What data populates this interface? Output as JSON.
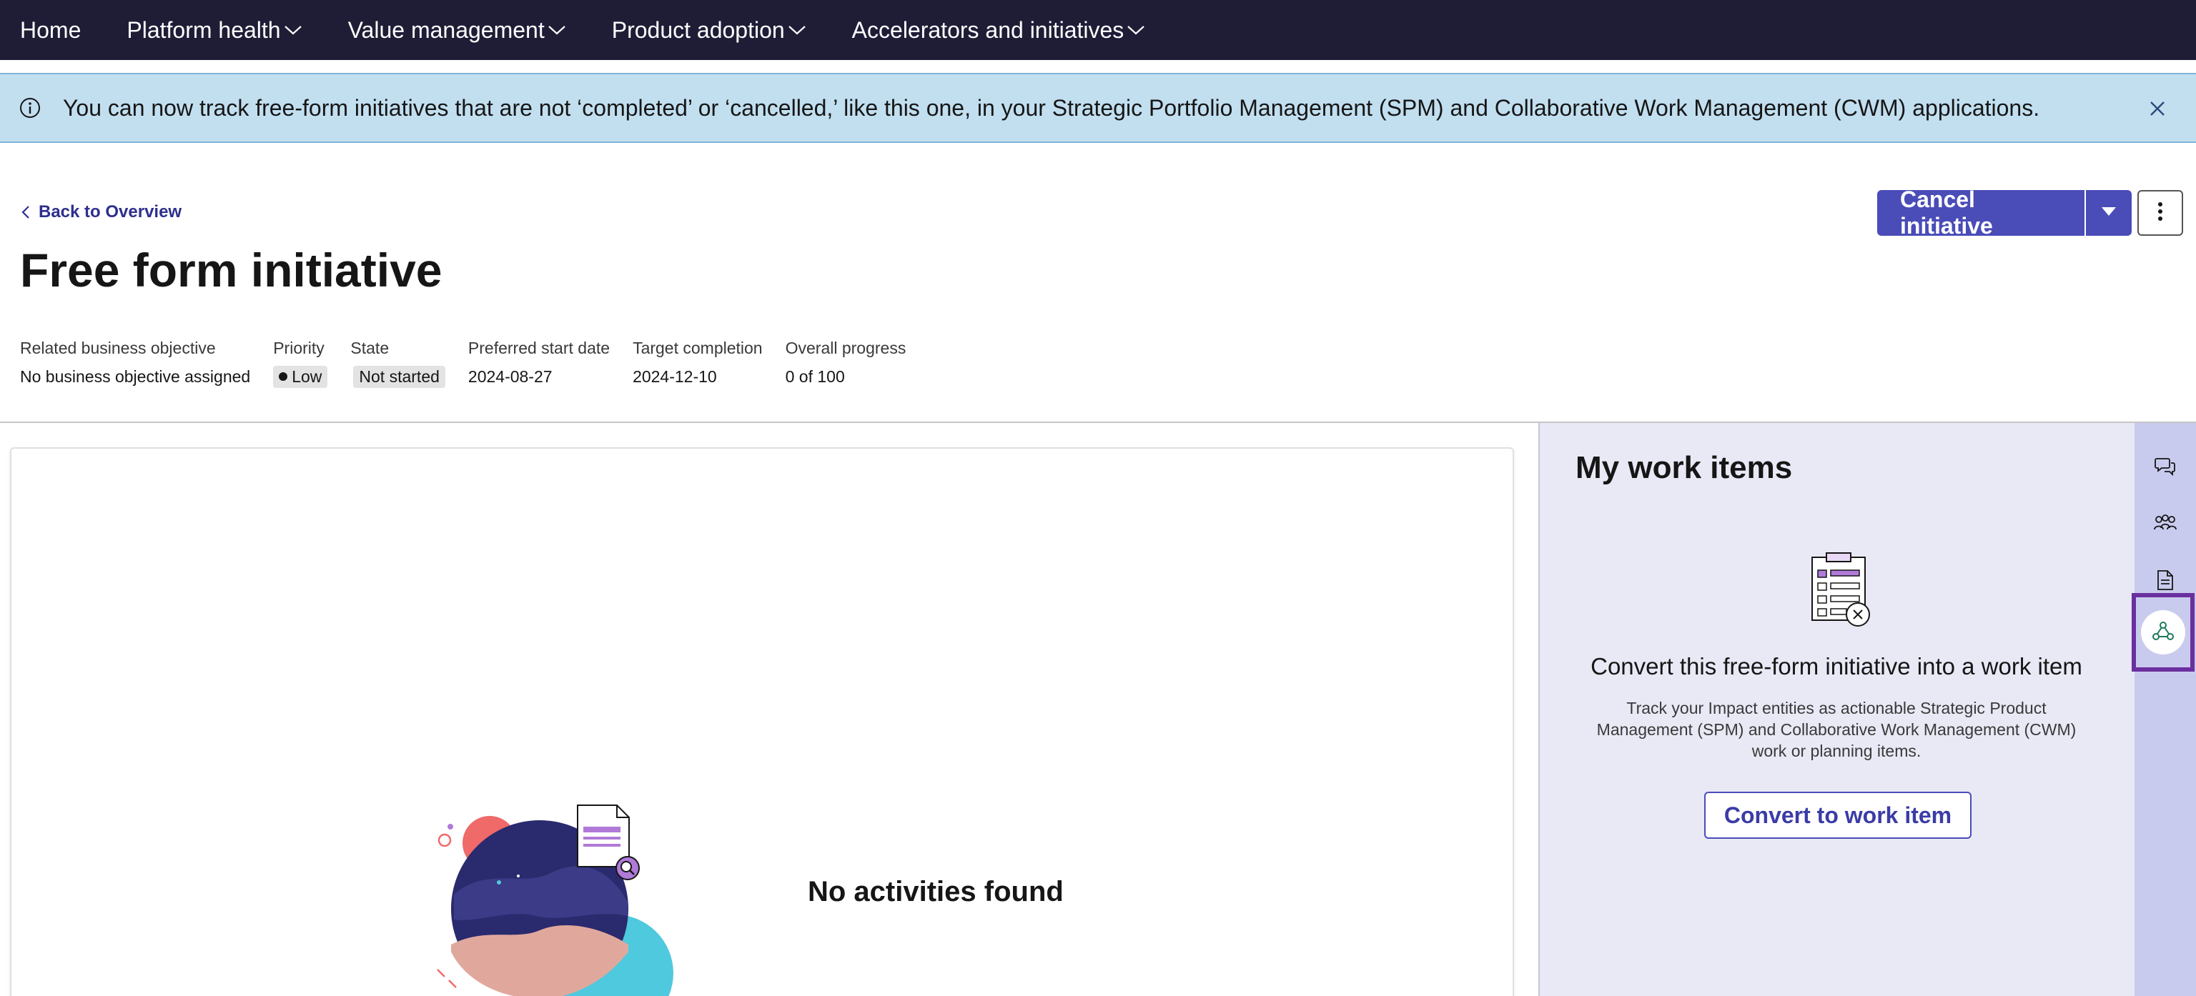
{
  "nav": {
    "items": [
      {
        "label": "Home",
        "dropdown": false
      },
      {
        "label": "Platform health",
        "dropdown": true
      },
      {
        "label": "Value management",
        "dropdown": true
      },
      {
        "label": "Product adoption",
        "dropdown": true
      },
      {
        "label": "Accelerators and initiatives",
        "dropdown": true
      }
    ]
  },
  "banner": {
    "icon": "info-icon",
    "text": "You can now track free-form initiatives that are not ‘completed’ or ‘cancelled,’ like this one, in your Strategic Portfolio Management (SPM) and Collaborative Work Management (CWM) applications."
  },
  "header": {
    "back_label": "Back to Overview",
    "title": "Free form initiative",
    "cancel_label": "Cancel initiative"
  },
  "meta": {
    "objective_label": "Related business objective",
    "objective_value": "No business objective assigned",
    "priority_label": "Priority",
    "priority_value": "Low",
    "state_label": "State",
    "state_value": "Not started",
    "start_label": "Preferred start date",
    "start_value": "2024-08-27",
    "target_label": "Target completion",
    "target_value": "2024-12-10",
    "progress_label": "Overall progress",
    "progress_value": "0 of 100"
  },
  "main": {
    "empty_text": "No activities found"
  },
  "panel": {
    "title": "My work items",
    "heading": "Convert this free-form initiative into a work item",
    "description": "Track your Impact entities as actionable Strategic Product Management (SPM) and Collaborative Work Management (CWM) work or planning items.",
    "button_label": "Convert to work item"
  },
  "rail": {
    "icons": [
      "chat-icon",
      "users-icon",
      "document-icon",
      "hierarchy-icon"
    ]
  },
  "colors": {
    "nav_bg": "#1f1d36",
    "banner_bg": "#c2dff0",
    "accent": "#4a4cb8",
    "panel_bg": "#e9e9f6",
    "rail_bg": "#c9cbee",
    "active_outline": "#6b2fa0"
  }
}
